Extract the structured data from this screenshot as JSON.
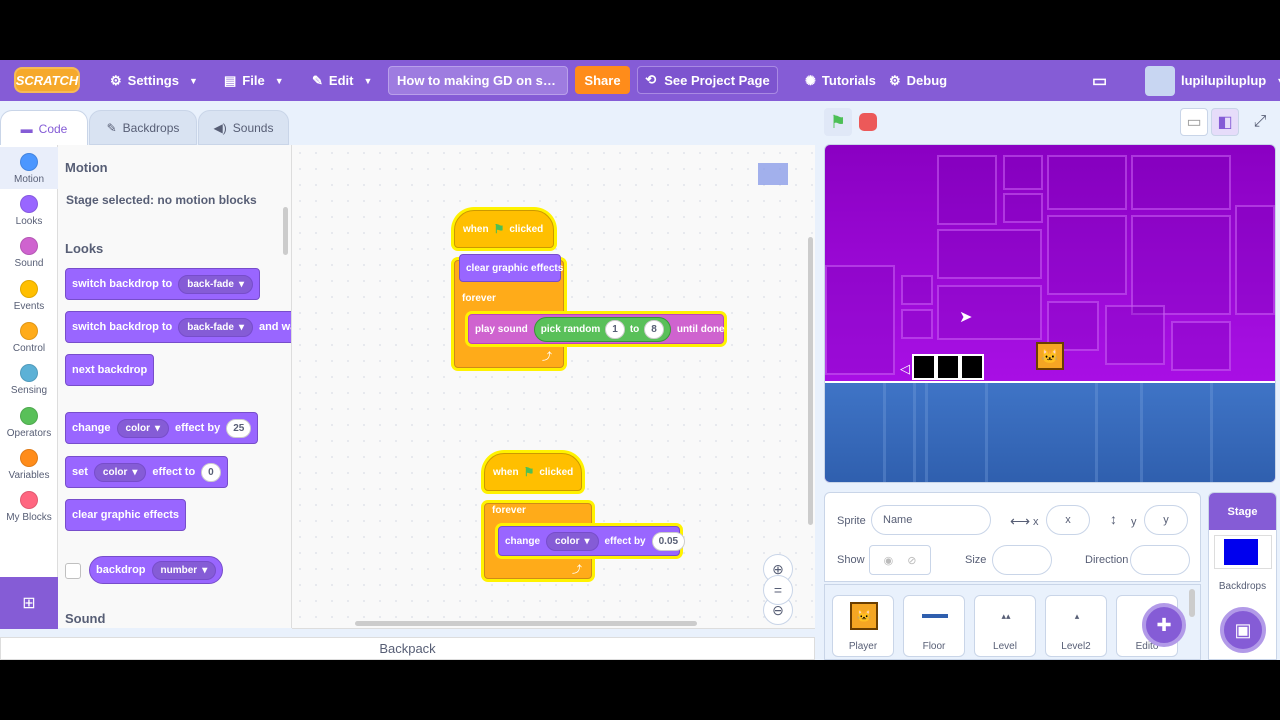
{
  "menubar": {
    "logo": "SCRATCH",
    "settings": "Settings",
    "file": "File",
    "edit": "Edit",
    "project_title": "How to making GD on scr...",
    "share": "Share",
    "see_project_page": "See Project Page",
    "tutorials": "Tutorials",
    "debug": "Debug",
    "username": "lupilupiluplup"
  },
  "tabs": {
    "code": "Code",
    "backdrops": "Backdrops",
    "sounds": "Sounds"
  },
  "categories": [
    {
      "label": "Motion",
      "color": "#4c97ff"
    },
    {
      "label": "Looks",
      "color": "#9966ff"
    },
    {
      "label": "Sound",
      "color": "#cf63cf"
    },
    {
      "label": "Events",
      "color": "#ffbf00"
    },
    {
      "label": "Control",
      "color": "#ffab19"
    },
    {
      "label": "Sensing",
      "color": "#5cb1d6"
    },
    {
      "label": "Operators",
      "color": "#59c059"
    },
    {
      "label": "Variables",
      "color": "#ff8c1a"
    },
    {
      "label": "My Blocks",
      "color": "#ff6680"
    }
  ],
  "palette": {
    "motion_heading": "Motion",
    "motion_note": "Stage selected: no motion blocks",
    "looks_heading": "Looks",
    "sound_heading": "Sound",
    "switch_backdrop": "switch backdrop to",
    "switch_backdrop_value": "back-fade",
    "switch_backdrop_wait": "switch backdrop to",
    "switch_backdrop_wait_value": "back-fade",
    "and_wait": "and wait",
    "next_backdrop": "next backdrop",
    "change": "change",
    "change_effect": "color",
    "effect_by": "effect by",
    "change_value": "25",
    "set": "set",
    "set_effect": "color",
    "effect_to": "effect to",
    "set_value": "0",
    "clear_effects": "clear graphic effects",
    "backdrop": "backdrop",
    "backdrop_value": "number"
  },
  "script1": {
    "when": "when",
    "clicked": "clicked",
    "clear_effects": "clear graphic effects",
    "forever": "forever",
    "play_sound": "play sound",
    "pick_random": "pick random",
    "from": "1",
    "to_label": "to",
    "to": "8",
    "until_done": "until done"
  },
  "script2": {
    "when": "when",
    "clicked": "clicked",
    "forever": "forever",
    "change": "change",
    "effect": "color",
    "effect_by": "effect by",
    "value": "0.05"
  },
  "backpack": "Backpack",
  "sprite_info": {
    "sprite_label": "Sprite",
    "name_placeholder": "Name",
    "x_label": "x",
    "x_placeholder": "x",
    "y_label": "y",
    "y_placeholder": "y",
    "show_label": "Show",
    "size_label": "Size",
    "direction_label": "Direction"
  },
  "sprites": [
    "Player",
    "Floor",
    "Level",
    "Level2",
    "Edito"
  ],
  "stage_panel": {
    "title": "Stage",
    "backdrops": "Backdrops"
  }
}
